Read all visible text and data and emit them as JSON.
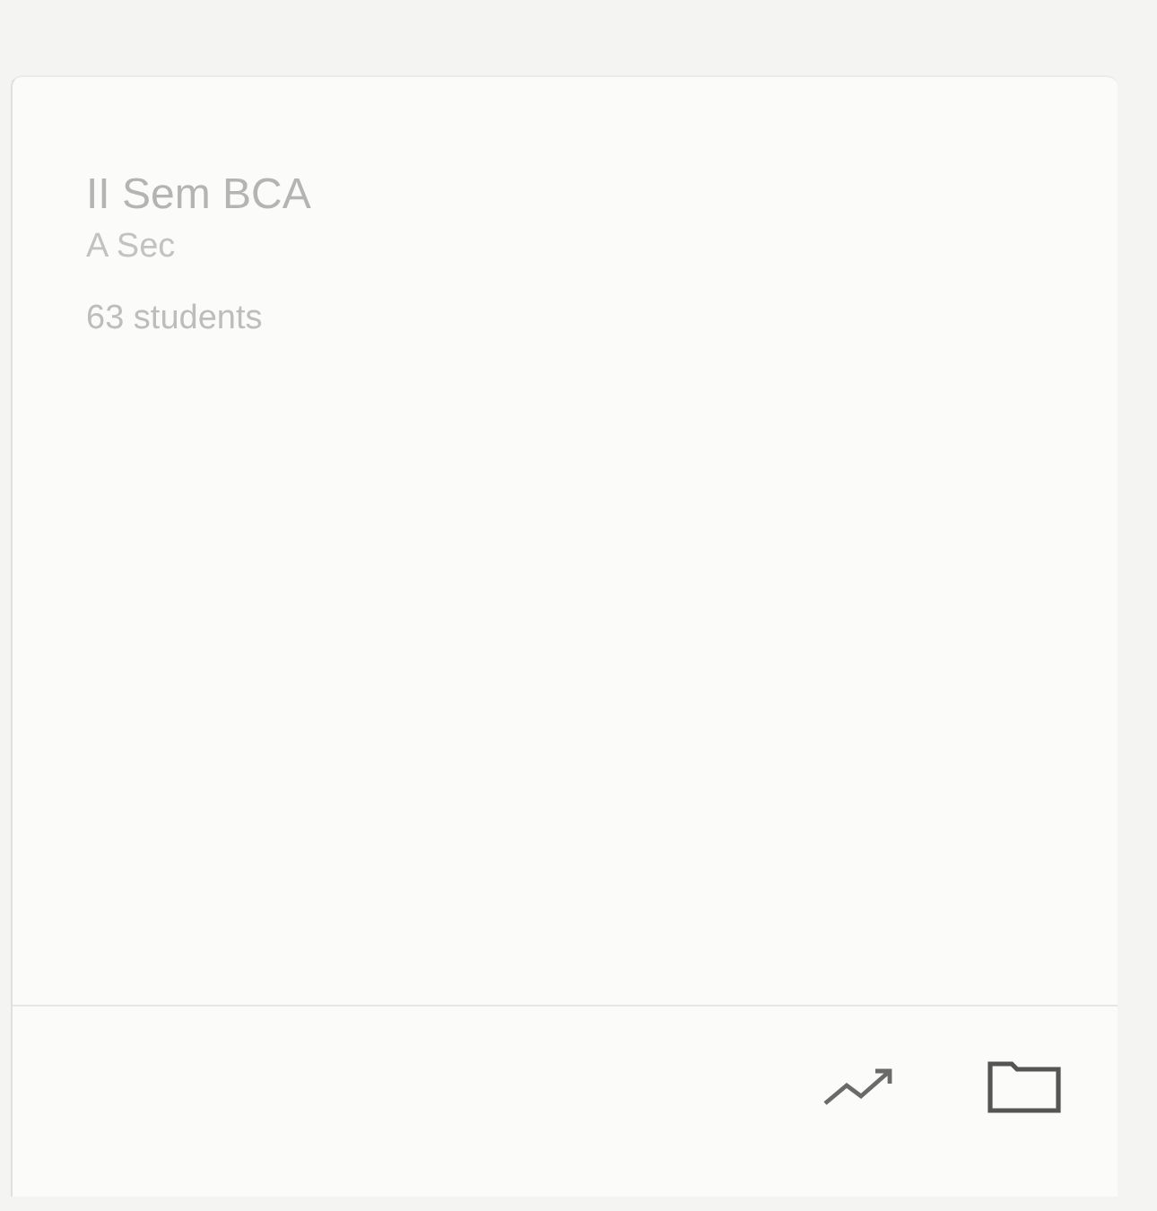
{
  "card": {
    "title": "II Sem BCA",
    "section": "A Sec",
    "students": "63 students"
  }
}
